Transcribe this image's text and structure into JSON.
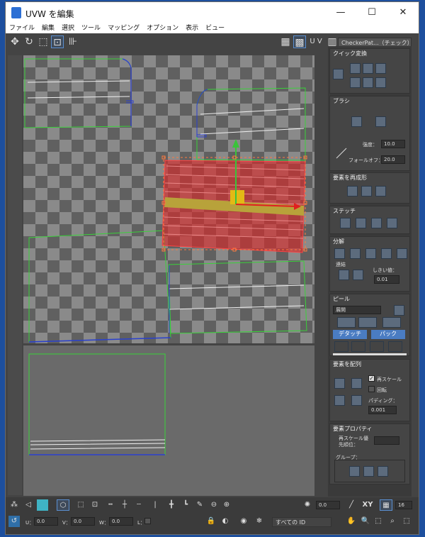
{
  "window": {
    "title": "UVW を編集",
    "minimize": "—",
    "maximize": "☐",
    "close": "✕"
  },
  "menu": [
    "ファイル",
    "編集",
    "選択",
    "ツール",
    "マッピング",
    "オプション",
    "表示",
    "ビュー"
  ],
  "toolbar": {
    "uv_label": "U V",
    "texture_dropdown": "CheckerPat...（チェック）"
  },
  "panel": {
    "quick": {
      "title": "クイック変換"
    },
    "brush": {
      "title": "ブラシ",
      "strength_label": "強度：",
      "strength_value": "10.0",
      "falloff_label": "フォールオフ：",
      "falloff_value": "20.0"
    },
    "reshape": {
      "title": "要素を再成形"
    },
    "stitch": {
      "title": "ステッチ"
    },
    "explode": {
      "title": "分解",
      "weld_label": "連結",
      "threshold_label": "しきい値：",
      "threshold_value": "0.01"
    },
    "peel": {
      "title": "ピール",
      "mode": "展開",
      "detach": "デタッチ",
      "pack": "パック"
    },
    "arrange": {
      "title": "要素を配列",
      "rescale": "再スケール",
      "rotate": "回転",
      "padding_label": "パディング：",
      "padding_value": "0.001"
    },
    "props": {
      "title": "要素プロパティ",
      "priority_label1": "再スケール優",
      "priority_label2": "先順位：",
      "group_label": "グループ："
    }
  },
  "bottom": {
    "angle": "0.0",
    "xy": "XY",
    "grid_value": "16",
    "u_label": "U：",
    "u_value": "0.0",
    "v_label": "V：",
    "v_value": "0.0",
    "w_label": "W：",
    "w_value": "0.0",
    "l_label": "L：",
    "id_select": "すべての ID"
  }
}
